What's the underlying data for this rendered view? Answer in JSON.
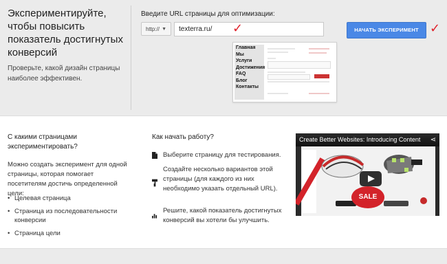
{
  "hero": {
    "title": "Экспериментируйте, чтобы повысить показатель достигнутых конверсий",
    "subtitle": "Проверьте, какой дизайн страницы наиболее эффективен."
  },
  "url_form": {
    "label": "Введите URL страницы для оптимизации:",
    "protocol": "http://",
    "url_value": "texterra.ru/",
    "start_button": "НАЧАТЬ ЭКСПЕРИМЕНТ",
    "check_mark": "✓"
  },
  "preview": {
    "nav": [
      "Главная",
      "Мы",
      "Услуги",
      "Достижения",
      "FAQ",
      "Блог",
      "Контакты"
    ]
  },
  "which_pages": {
    "heading": "С какими страницами экспериментировать?",
    "intro": "Можно создать эксперимент для одной страницы, которая помогает посетителям достичь определенной цели:",
    "items": [
      "Целевая страница",
      "Страница из последовательности конверсии",
      "Страница цели"
    ]
  },
  "how_to_start": {
    "heading": "Как начать работу?",
    "steps": [
      {
        "icon": "document-icon",
        "text": "Выберите страницу для тестирования."
      },
      {
        "icon": "paint-roller-icon",
        "text": "Создайте несколько вариантов этой страницы (для каждого из них необходимо указать отдельный URL)."
      },
      {
        "icon": "bar-chart-icon",
        "text": "Решите, какой показатель достигнутых конверсий вы хотели бы улучшить."
      }
    ]
  },
  "video": {
    "title": "Create Better Websites: Introducing Content",
    "badge": "SALE"
  },
  "colors": {
    "accent_button": "#4a88e6",
    "check_red": "#e0202a",
    "band_gray": "#ebebeb"
  }
}
